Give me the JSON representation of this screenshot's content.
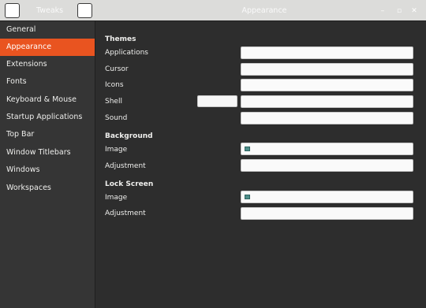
{
  "window": {
    "left_title": "Tweaks",
    "center_title": "Appearance",
    "controls": {
      "minimize": "–",
      "maximize": "▫",
      "close": "✕"
    }
  },
  "sidebar": {
    "items": [
      {
        "label": "General"
      },
      {
        "label": "Appearance",
        "active": true
      },
      {
        "label": "Extensions"
      },
      {
        "label": "Fonts"
      },
      {
        "label": "Keyboard & Mouse"
      },
      {
        "label": "Startup Applications"
      },
      {
        "label": "Top Bar"
      },
      {
        "label": "Window Titlebars"
      },
      {
        "label": "Windows"
      },
      {
        "label": "Workspaces"
      }
    ]
  },
  "main": {
    "themes": {
      "heading": "Themes",
      "applications": "Applications",
      "cursor": "Cursor",
      "icons": "Icons",
      "shell": "Shell",
      "sound": "Sound"
    },
    "background": {
      "heading": "Background",
      "image": "Image",
      "adjustment": "Adjustment"
    },
    "lock_screen": {
      "heading": "Lock Screen",
      "image": "Image",
      "adjustment": "Adjustment"
    }
  },
  "colors": {
    "accent": "#e95420",
    "sidebar_bg": "#353535",
    "content_bg": "#2d2d2d",
    "headerbar_bg": "#dcdcda"
  },
  "icons": {
    "image_placeholder": "image-icon"
  }
}
